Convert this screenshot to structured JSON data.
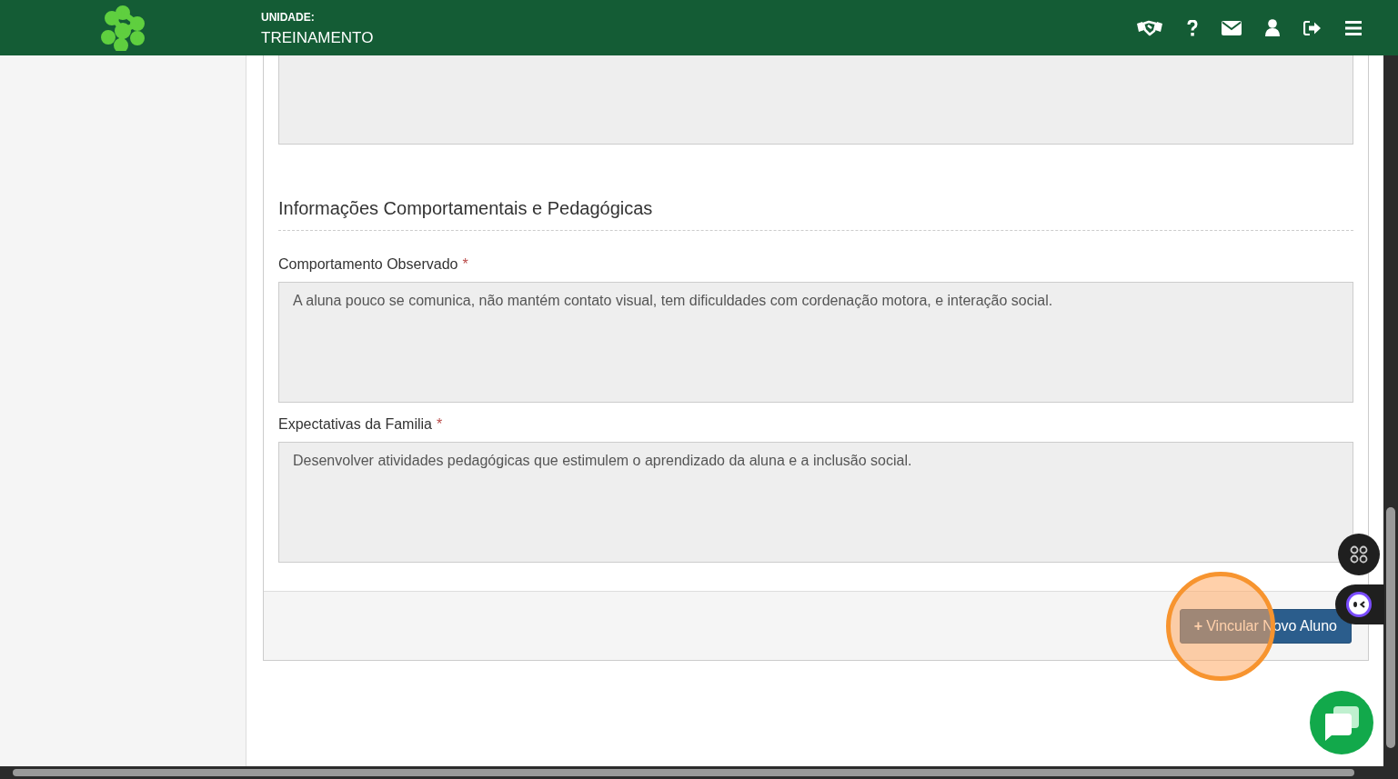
{
  "header": {
    "unit_label": "UNIDADE:",
    "unit_name": "TREINAMENTO"
  },
  "section": {
    "title": "Informações Comportamentais e Pedagógicas"
  },
  "fields": [
    {
      "label": "Comportamento Observado",
      "required_mark": "*",
      "value": "A aluna pouco se comunica, não mantém contato visual, tem dificuldades com cordenação motora, e interação social."
    },
    {
      "label": "Expectativas da Familia",
      "required_mark": "*",
      "value": "Desenvolver atividades pedagógicas que estimulem o aprendizado da aluna e a inclusão social."
    }
  ],
  "footer": {
    "button_icon": "+",
    "button_label": "Vincular Novo Aluno"
  }
}
